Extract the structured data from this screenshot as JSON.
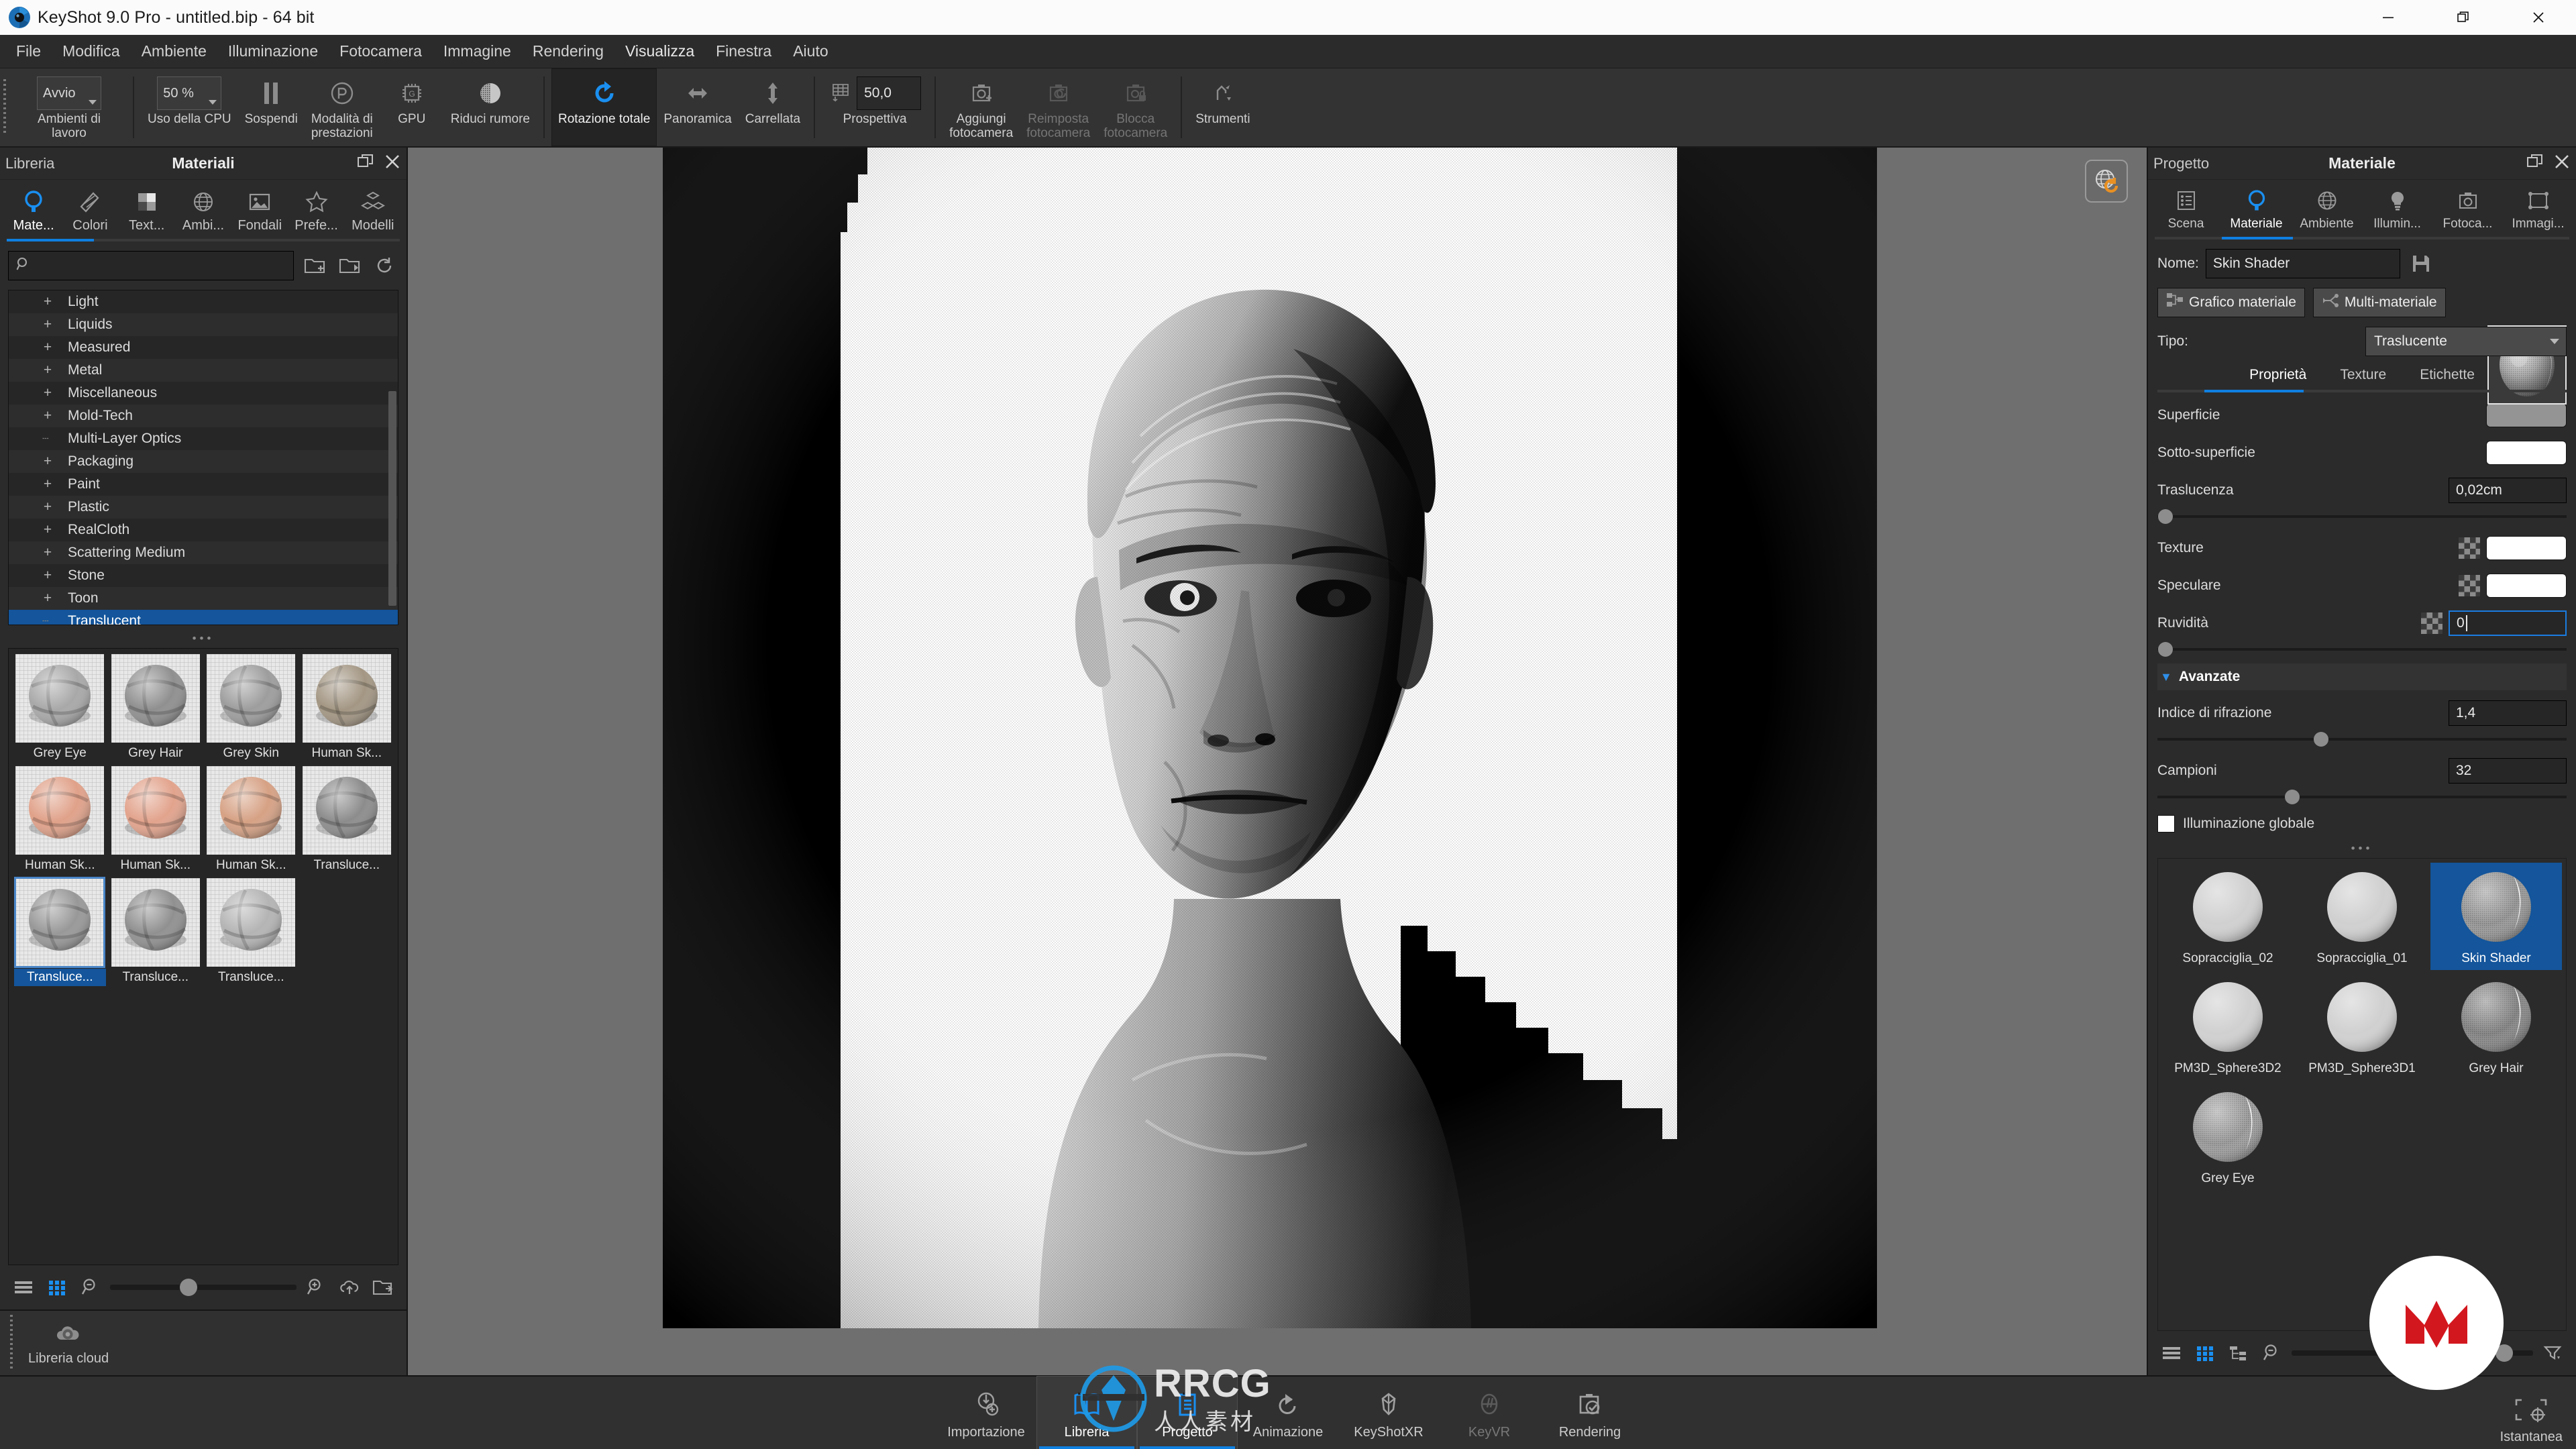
{
  "window": {
    "title": "KeyShot 9.0 Pro  - untitled.bip  - 64 bit",
    "minimize": "minimize-icon",
    "restore": "restore-icon",
    "close": "close-icon"
  },
  "menubar": {
    "items": [
      {
        "label": "File"
      },
      {
        "label": "Modifica"
      },
      {
        "label": "Ambiente"
      },
      {
        "label": "Illuminazione"
      },
      {
        "label": "Fotocamera"
      },
      {
        "label": "Immagine"
      },
      {
        "label": "Rendering"
      },
      {
        "label": "Visualizza"
      },
      {
        "label": "Finestra"
      },
      {
        "label": "Aiuto"
      }
    ]
  },
  "toolbar": {
    "workspace": {
      "label": "Ambienti di lavoro",
      "value": "Avvio"
    },
    "cpu": {
      "label": "Uso della CPU",
      "value": "50 %"
    },
    "pause": {
      "label": "Sospendi",
      "icon": "pause-icon"
    },
    "performance": {
      "label": "Modalità di\nprestazioni",
      "icon": "performance-icon"
    },
    "gpu": {
      "label": "GPU",
      "icon": "gpu-chip-icon"
    },
    "denoise": {
      "label": "Riduci rumore",
      "icon": "denoise-sphere-icon"
    },
    "orbit": {
      "label": "Rotazione totale",
      "icon": "orbit-arrow-icon"
    },
    "pan": {
      "label": "Panoramica",
      "icon": "pan-icon"
    },
    "dolly": {
      "label": "Carrellata",
      "icon": "dolly-arrow-icon"
    },
    "perspective": {
      "label": "Prospettiva",
      "value": "50,0",
      "icon": "perspective-grid-icon"
    },
    "add_camera": {
      "label": "Aggiungi\nfotocamera",
      "icon": "camera-plus-icon"
    },
    "reset_camera": {
      "label": "Reimposta\nfotocamera",
      "icon": "camera-reset-icon"
    },
    "lock_camera": {
      "label": "Blocca\nfotocamera",
      "icon": "camera-lock-icon"
    },
    "tools": {
      "label": "Strumenti",
      "icon": "tools-icon"
    }
  },
  "library": {
    "header_left": "Libreria",
    "header_title": "Materiali",
    "undock_icon": "undock-icon",
    "close_icon": "close-icon",
    "tabs": [
      {
        "label": "Mate...",
        "icon": "material-ball-icon",
        "selected": true
      },
      {
        "label": "Colori",
        "icon": "color-swatch-icon",
        "selected": false
      },
      {
        "label": "Text...",
        "icon": "checker-texture-icon",
        "selected": false
      },
      {
        "label": "Ambi...",
        "icon": "globe-icon",
        "selected": false
      },
      {
        "label": "Fondali",
        "icon": "image-icon",
        "selected": false
      },
      {
        "label": "Prefe...",
        "icon": "star-icon",
        "selected": false
      },
      {
        "label": "Modelli",
        "icon": "cubes-icon",
        "selected": false
      }
    ],
    "search": {
      "value": "",
      "placeholder": "",
      "icon": "search-icon"
    },
    "search_buttons": [
      {
        "icon": "folder-add-icon"
      },
      {
        "icon": "folder-import-icon"
      },
      {
        "icon": "refresh-icon"
      }
    ],
    "tree": [
      {
        "label": "Light",
        "expandable": true,
        "selected": false
      },
      {
        "label": "Liquids",
        "expandable": true,
        "selected": false
      },
      {
        "label": "Measured",
        "expandable": true,
        "selected": false
      },
      {
        "label": "Metal",
        "expandable": true,
        "selected": false
      },
      {
        "label": "Miscellaneous",
        "expandable": true,
        "selected": false
      },
      {
        "label": "Mold-Tech",
        "expandable": true,
        "selected": false
      },
      {
        "label": "Multi-Layer Optics",
        "expandable": false,
        "selected": false
      },
      {
        "label": "Packaging",
        "expandable": true,
        "selected": false
      },
      {
        "label": "Paint",
        "expandable": true,
        "selected": false
      },
      {
        "label": "Plastic",
        "expandable": true,
        "selected": false
      },
      {
        "label": "RealCloth",
        "expandable": true,
        "selected": false
      },
      {
        "label": "Scattering Medium",
        "expandable": true,
        "selected": false
      },
      {
        "label": "Stone",
        "expandable": true,
        "selected": false
      },
      {
        "label": "Toon",
        "expandable": true,
        "selected": false
      },
      {
        "label": "Translucent",
        "expandable": false,
        "selected": true
      }
    ],
    "materials": [
      {
        "name": "Grey Eye",
        "color": "#a8a8a8",
        "selected": false
      },
      {
        "name": "Grey Hair",
        "color": "#8f8f8f",
        "selected": false
      },
      {
        "name": "Grey Skin",
        "color": "#9d9d9d",
        "selected": false
      },
      {
        "name": "Human Sk...",
        "color": "#a39683",
        "selected": false
      },
      {
        "name": "Human Sk...",
        "color": "#e0a189",
        "selected": false
      },
      {
        "name": "Human Sk...",
        "color": "#e2a38c",
        "selected": false
      },
      {
        "name": "Human Sk...",
        "color": "#d6a184",
        "selected": false
      },
      {
        "name": "Transluce...",
        "color": "#8c8c8c",
        "selected": false
      },
      {
        "name": "Transluce...",
        "color": "#989898",
        "selected": true
      },
      {
        "name": "Transluce...",
        "color": "#909090",
        "selected": false
      },
      {
        "name": "Transluce...",
        "color": "#b4b4b4",
        "selected": false
      }
    ],
    "footer": {
      "list_view_icon": "list-view-icon",
      "grid_view_icon": "grid-view-icon",
      "zoom_out_icon": "zoom-out-icon",
      "zoom_in_icon": "zoom-in-icon",
      "zoom_value": 42,
      "cloud_upload_icon": "cloud-upload-icon",
      "folder_open_icon": "folder-open-icon"
    },
    "cloud": {
      "label": "Libreria cloud",
      "icon": "cloud-library-icon"
    }
  },
  "viewport": {
    "globe_icon": "globe-refresh-icon",
    "scene": "3d-head-bust-render"
  },
  "project": {
    "header_left": "Progetto",
    "header_title": "Materiale",
    "undock_icon": "undock-icon",
    "close_icon": "close-icon",
    "tabs": [
      {
        "label": "Scena",
        "icon": "scene-list-icon",
        "selected": false
      },
      {
        "label": "Materiale",
        "icon": "material-ball-icon",
        "selected": true
      },
      {
        "label": "Ambiente",
        "icon": "globe-icon",
        "selected": false
      },
      {
        "label": "Illumin...",
        "icon": "lightbulb-icon",
        "selected": false
      },
      {
        "label": "Fotoca...",
        "icon": "camera-icon",
        "selected": false
      },
      {
        "label": "Immagi...",
        "icon": "image-frame-icon",
        "selected": false
      }
    ],
    "name_label": "Nome:",
    "name_value": "Skin Shader",
    "save_icon": "save-disk-icon",
    "preview_icon": "material-preview-sphere",
    "material_graph_button": "Grafico materiale",
    "material_graph_icon": "node-graph-icon",
    "multi_material_button": "Multi-materiale",
    "multi_material_icon": "multi-material-icon",
    "type_label": "Tipo:",
    "type_value": "Traslucente",
    "subtabs": [
      {
        "label": "Proprietà",
        "selected": true
      },
      {
        "label": "Texture",
        "selected": false
      },
      {
        "label": "Etichette",
        "selected": false
      }
    ],
    "properties": [
      {
        "name": "Superficie",
        "kind": "color",
        "color": "#949494"
      },
      {
        "name": "Sotto-superficie",
        "kind": "color",
        "color": "#ffffff"
      },
      {
        "name": "Traslucenza",
        "kind": "value",
        "value": "0,02cm",
        "slider": 2
      },
      {
        "name": "Texture",
        "kind": "tex",
        "color": "#ffffff",
        "texture_icon": "checker-texture-icon"
      },
      {
        "name": "Speculare",
        "kind": "tex",
        "color": "#ffffff",
        "texture_icon": "checker-texture-icon"
      },
      {
        "name": "Ruvidità",
        "kind": "input",
        "value": "0",
        "slider": 2,
        "texture_icon": "checker-texture-icon",
        "focused": true
      }
    ],
    "advanced": {
      "label": "Avanzate",
      "chevron_icon": "chevron-down-icon",
      "rows": [
        {
          "name": "Indice di rifrazione",
          "value": "1,4",
          "slider": 40
        },
        {
          "name": "Campioni",
          "value": "32",
          "slider": 33
        }
      ],
      "checkbox": {
        "label": "Illuminazione globale",
        "checked": false
      }
    },
    "scene_materials": [
      {
        "name": "Sopracciglia_02",
        "color": "#d0d0d0",
        "kind": "plain",
        "selected": false
      },
      {
        "name": "Sopracciglia_01",
        "color": "#d0d0d0",
        "kind": "plain",
        "selected": false
      },
      {
        "name": "Skin Shader",
        "color": "#9b9b9b",
        "kind": "dither",
        "selected": true
      },
      {
        "name": "PM3D_Sphere3D2",
        "color": "#d0d0d0",
        "kind": "plain",
        "selected": false
      },
      {
        "name": "PM3D_Sphere3D1",
        "color": "#d0d0d0",
        "kind": "plain",
        "selected": false
      },
      {
        "name": "Grey Hair",
        "color": "#8a8a8a",
        "kind": "dither",
        "selected": false
      },
      {
        "name": "Grey Eye",
        "color": "#a0a0a0",
        "kind": "dither",
        "selected": false
      }
    ],
    "footer": {
      "list_view_icon": "list-view-icon",
      "grid_view_icon": "grid-view-icon",
      "tree_view_icon": "tree-view-icon",
      "zoom_out_icon": "zoom-out-icon",
      "zoom_value": 88,
      "filter_icon": "filter-icon"
    }
  },
  "bottombar": {
    "items": [
      {
        "label": "Importazione",
        "icon": "import-icon",
        "state": "normal"
      },
      {
        "label": "Libreria",
        "icon": "book-icon",
        "state": "selected"
      },
      {
        "label": "Progetto",
        "icon": "project-list-icon",
        "state": "selected"
      },
      {
        "label": "Animazione",
        "icon": "animation-icon",
        "state": "normal"
      },
      {
        "label": "KeyShotXR",
        "icon": "keyshotxr-icon",
        "state": "normal"
      },
      {
        "label": "KeyVR",
        "icon": "keyvr-icon",
        "state": "disabled"
      },
      {
        "label": "Rendering",
        "icon": "render-check-icon",
        "state": "normal"
      }
    ],
    "snapshot": {
      "label": "Istantanea",
      "icon": "snapshot-crosshair-icon"
    }
  },
  "overlays": {
    "watermark_text": "RRCG",
    "watermark_sub": "人人素材",
    "watermark_icon": "rrcg-logo-icon",
    "maxon_logo": "maxon-m-logo",
    "maxon_color": "#d3171e"
  },
  "colors": {
    "accent": "#0f7fe0",
    "selection": "#14559b",
    "panel_bg": "#2b2b2b",
    "toolbar_bg": "#333333",
    "viewport_bg": "#6f6f6f"
  }
}
